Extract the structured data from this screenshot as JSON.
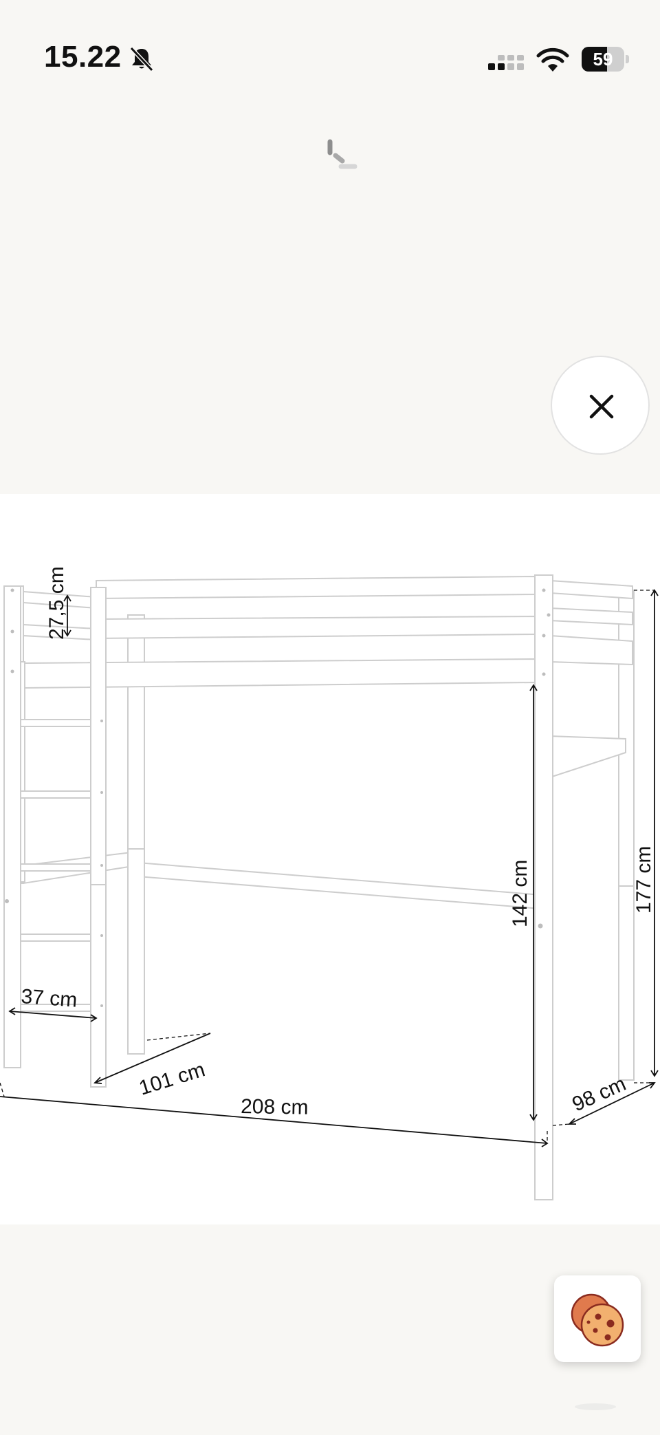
{
  "status_bar": {
    "time": "15.22",
    "battery_level": "59",
    "battery_fraction": 0.59,
    "icons": [
      "bell-slash-icon",
      "cellular-signal-icon",
      "wifi-icon",
      "battery-icon"
    ]
  },
  "loading": {
    "icon": "loading-spinner-icon"
  },
  "close_button": {
    "icon": "close-icon"
  },
  "product_image": {
    "description_icon": "loft-bed-dimension-drawing",
    "dimensions": {
      "rail_height": "27,5 cm",
      "ladder_width": "37 cm",
      "width_front": "101 cm",
      "length": "208 cm",
      "under_bed_height": "142 cm",
      "total_height": "177 cm",
      "width_side": "98 cm"
    }
  },
  "cookie_button": {
    "icon": "cookie-icon"
  },
  "colors": {
    "page_background": "#f8f7f4",
    "image_background": "#ffffff",
    "bed_stroke": "#c9c9c9",
    "cookie_orange": "#e07a4d",
    "cookie_dark": "#8a2b1f"
  }
}
